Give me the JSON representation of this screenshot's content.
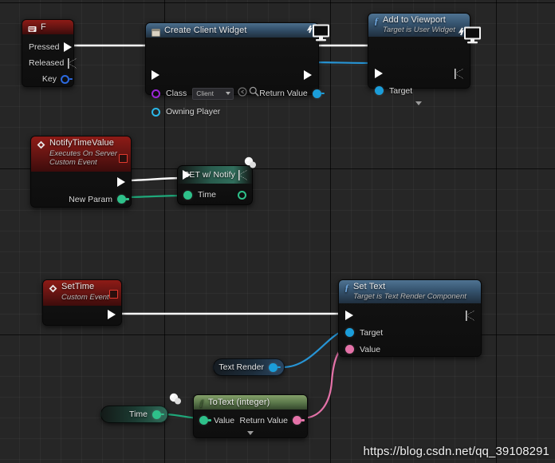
{
  "canvas": {
    "background_color": "#262626",
    "grid_minor_color": "#2e2e2e",
    "grid_major_color": "#0d0d0d"
  },
  "watermark": {
    "text": "https://blog.csdn.net/qq_39108291"
  },
  "nodes": {
    "input_f": {
      "title": "F",
      "icon": "keyboard-icon",
      "header_color": "#7e1815",
      "pins": [
        {
          "label": "Pressed",
          "type": "exec",
          "state": "connected"
        },
        {
          "label": "Released",
          "type": "exec",
          "state": "unconnected"
        },
        {
          "label": "Key",
          "type": "data",
          "color": "#2c6ae0",
          "state": "unconnected"
        }
      ]
    },
    "create_client_widget": {
      "title": "Create Client Widget",
      "icon": "widget-icon",
      "badge": "client-only-monitor-icon",
      "header_color": "#33506b",
      "exec_in": "",
      "exec_out": "",
      "class_label": "Class",
      "class_value": "Client",
      "class_pin_color": "#9b27d8",
      "browse_icon": "browse-asset-icon",
      "search_icon": "find-asset-icon",
      "owning_player_label": "Owning Player",
      "owning_player_color": "#2bb7e8",
      "return_value_label": "Return Value",
      "return_value_color": "#1b9dd9"
    },
    "add_to_viewport": {
      "title": "Add to Viewport",
      "subtitle": "Target is User Widget",
      "icon": "function-f-icon",
      "badge": "client-only-monitor-icon",
      "header_color": "#35536e",
      "target_label": "Target",
      "target_color": "#1b9dd9",
      "expander": "chevron-down-icon"
    },
    "notify_time_value": {
      "title": "NotifyTimeValue",
      "subtitle_1": "Executes On Server",
      "subtitle_2": "Custom Event",
      "icon": "custom-event-diamond-icon",
      "replicate_icon": "replication-box-icon",
      "header_color": "#7e1815",
      "param_label": "New Param",
      "param_color": "#2ec18a"
    },
    "set_w_notify": {
      "title": "SET w/ Notify",
      "orb_icon": "variable-orb-icon",
      "header_color": "#2d6958",
      "time_label": "Time",
      "time_color": "#2ec18a",
      "time_out_color": "#2ec18a"
    },
    "set_time": {
      "title": "SetTime",
      "subtitle": "Custom Event",
      "icon": "custom-event-diamond-icon",
      "replicate_icon": "replication-box-icon",
      "header_color": "#7e1815"
    },
    "set_text": {
      "title": "Set Text",
      "subtitle": "Target is Text Render Component",
      "icon": "function-f-icon",
      "header_color": "#35536e",
      "target_label": "Target",
      "target_color": "#1b9dd9",
      "value_label": "Value",
      "value_color": "#e472a8"
    },
    "text_render_var": {
      "title": "Text Render",
      "pin_color": "#1b9dd9"
    },
    "to_text_integer": {
      "title": "ToText (integer)",
      "icon": "function-f-icon",
      "header_color": "#5d7a4c",
      "value_label": "Value",
      "value_color": "#2ec18a",
      "return_value_label": "Return Value",
      "return_value_color": "#e472a8",
      "expander": "chevron-down-icon"
    },
    "time_var": {
      "title": "Time",
      "pin_color": "#2ec18a",
      "orb_icon": "variable-orb-icon"
    }
  },
  "wires": [
    {
      "from": "input_f.Pressed",
      "to": "create_client_widget.exec_in",
      "color": "#ffffff",
      "kind": "exec"
    },
    {
      "from": "create_client_widget.exec_out",
      "to": "add_to_viewport.exec_in",
      "color": "#ffffff",
      "kind": "exec"
    },
    {
      "from": "create_client_widget.Return Value",
      "to": "add_to_viewport.Target",
      "color": "#2794d4",
      "kind": "data"
    },
    {
      "from": "notify_time_value.exec_out",
      "to": "set_w_notify.exec_in",
      "color": "#ffffff",
      "kind": "exec"
    },
    {
      "from": "notify_time_value.New Param",
      "to": "set_w_notify.Time",
      "color": "#1fa87a",
      "kind": "data"
    },
    {
      "from": "set_time.exec_out",
      "to": "set_text.exec_in",
      "color": "#ffffff",
      "kind": "exec"
    },
    {
      "from": "text_render_var.out",
      "to": "set_text.Target",
      "color": "#2794d4",
      "kind": "data"
    },
    {
      "from": "to_text_integer.Return Value",
      "to": "set_text.Value",
      "color": "#e472a8",
      "kind": "data"
    },
    {
      "from": "time_var.out",
      "to": "to_text_integer.Value",
      "color": "#1fa87a",
      "kind": "data"
    }
  ]
}
